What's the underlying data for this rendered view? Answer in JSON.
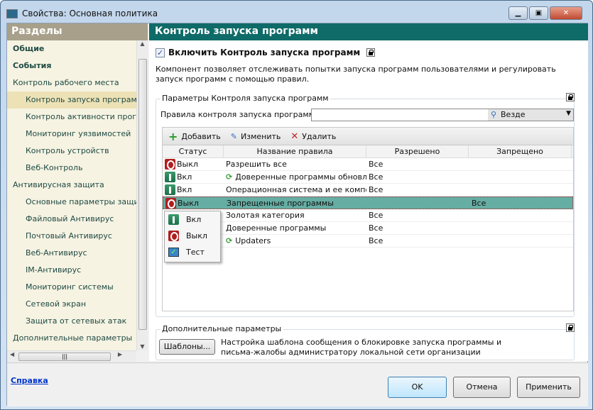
{
  "window": {
    "title": "Свойства: Основная политика"
  },
  "sidebar": {
    "header": "Разделы",
    "items": [
      {
        "label": "Общие",
        "bold": true,
        "sub": false
      },
      {
        "label": "События",
        "bold": true,
        "sub": false
      },
      {
        "label": "Контроль рабочего места",
        "bold": false,
        "sub": false
      },
      {
        "label": "Контроль запуска програм",
        "bold": false,
        "sub": true,
        "selected": true
      },
      {
        "label": "Контроль активности програм",
        "bold": false,
        "sub": true
      },
      {
        "label": "Мониторинг уязвимостей",
        "bold": false,
        "sub": true
      },
      {
        "label": "Контроль устройств",
        "bold": false,
        "sub": true
      },
      {
        "label": "Веб-Контроль",
        "bold": false,
        "sub": true
      },
      {
        "label": "Антивирусная защита",
        "bold": false,
        "sub": false
      },
      {
        "label": "Основные параметры защиты",
        "bold": false,
        "sub": true
      },
      {
        "label": "Файловый Антивирус",
        "bold": false,
        "sub": true
      },
      {
        "label": "Почтовый Антивирус",
        "bold": false,
        "sub": true
      },
      {
        "label": "Веб-Антивирус",
        "bold": false,
        "sub": true
      },
      {
        "label": "IM-Антивирус",
        "bold": false,
        "sub": true
      },
      {
        "label": "Мониторинг системы",
        "bold": false,
        "sub": true
      },
      {
        "label": "Сетевой экран",
        "bold": false,
        "sub": true
      },
      {
        "label": "Защита от сетевых атак",
        "bold": false,
        "sub": true
      },
      {
        "label": "Дополнительные параметры",
        "bold": false,
        "sub": false
      }
    ]
  },
  "main": {
    "header": "Контроль запуска программ",
    "enable_label": "Включить Контроль запуска программ",
    "enable_checked": true,
    "description": "Компонент позволяет отслеживать попытки запуска программ пользователями и регулировать запуск программ с помощью правил.",
    "group1_label": "Параметры Контроля запуска программ",
    "rules_label": "Правила контроля запуска программ:",
    "rules_filter": "Везде",
    "toolbar": {
      "add": "Добавить",
      "edit": "Изменить",
      "delete": "Удалить"
    },
    "columns": [
      "Статус",
      "Название правила",
      "Разрешено",
      "Запрещено"
    ],
    "rows": [
      {
        "status": "off",
        "status_label": "Выкл",
        "name": "Разрешить все",
        "sync": false,
        "allowed": "Все",
        "denied": ""
      },
      {
        "status": "on",
        "status_label": "Вкл",
        "name": "Доверенные программы обновл...",
        "sync": true,
        "allowed": "Все",
        "denied": ""
      },
      {
        "status": "on",
        "status_label": "Вкл",
        "name": "Операционная система и ее компон...",
        "sync": false,
        "allowed": "Все",
        "denied": ""
      },
      {
        "status": "off",
        "status_label": "Выкл",
        "name": "Запрещенные программы",
        "sync": false,
        "allowed": "",
        "denied": "Все",
        "selected": true
      },
      {
        "status": "",
        "status_label": "",
        "name": "Золотая категория",
        "sync": false,
        "allowed": "Все",
        "denied": ""
      },
      {
        "status": "",
        "status_label": "",
        "name": "Доверенные программы",
        "sync": false,
        "allowed": "Все",
        "denied": ""
      },
      {
        "status": "",
        "status_label": "",
        "name": "Updaters",
        "sync": true,
        "allowed": "Все",
        "denied": ""
      }
    ],
    "status_menu": [
      "Вкл",
      "Выкл",
      "Тест"
    ],
    "group2_label": "Дополнительные параметры",
    "templates_button": "Шаблоны...",
    "templates_desc": "Настройка шаблона сообщения о блокировке запуска программы и письма-жалобы администратору локальной сети организации"
  },
  "footer": {
    "help": "Справка",
    "ok": "OK",
    "cancel": "Отмена",
    "apply": "Применить"
  }
}
